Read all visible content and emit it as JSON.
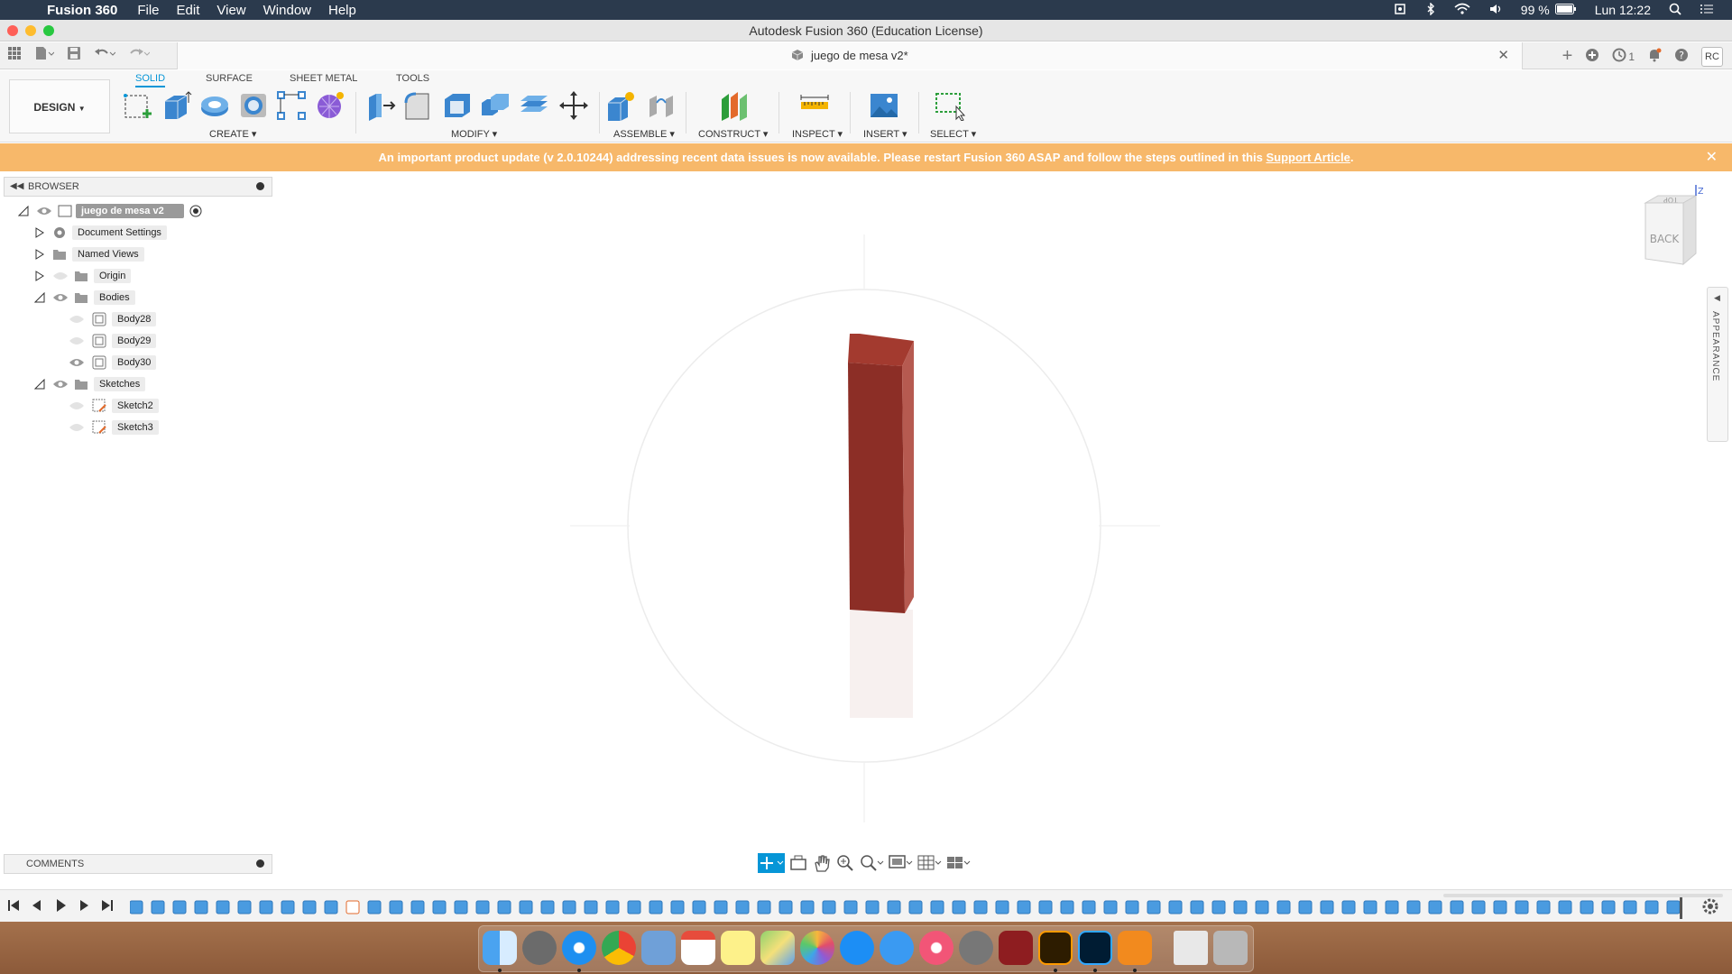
{
  "menubar": {
    "app_name": "Fusion 360",
    "menus": [
      "File",
      "Edit",
      "View",
      "Window",
      "Help"
    ],
    "battery": "99 %",
    "clock": "Lun 12:22"
  },
  "window": {
    "title": "Autodesk Fusion 360 (Education License)"
  },
  "tabbar": {
    "document_tab": "juego de mesa v2*",
    "job_count": "1",
    "user_initials": "RC"
  },
  "toolbar": {
    "workspace": "DESIGN",
    "tabs": [
      "SOLID",
      "SURFACE",
      "SHEET METAL",
      "TOOLS"
    ],
    "groups": [
      "CREATE",
      "MODIFY",
      "ASSEMBLE",
      "CONSTRUCT",
      "INSPECT",
      "INSERT",
      "SELECT"
    ]
  },
  "banner": {
    "message": "An important product update (v 2.0.10244) addressing recent data issues is now available. Please restart Fusion 360 ASAP and follow the steps outlined in this",
    "link": "Support Article",
    "suffix": "."
  },
  "browser": {
    "title": "BROWSER",
    "root": "juego de mesa v2",
    "items": {
      "document_settings": "Document Settings",
      "named_views": "Named Views",
      "origin": "Origin",
      "bodies": "Bodies",
      "body28": "Body28",
      "body29": "Body29",
      "body30": "Body30",
      "sketches": "Sketches",
      "sketch2": "Sketch2",
      "sketch3": "Sketch3"
    }
  },
  "viewcube": {
    "face": "BACK",
    "top": "TOP",
    "axis": "Z"
  },
  "appearance_panel": "APPEARANCE",
  "comments": {
    "title": "COMMENTS"
  },
  "colors": {
    "accent": "#0696d7",
    "banner": "#f7b86a",
    "body": "#8c2e26"
  }
}
